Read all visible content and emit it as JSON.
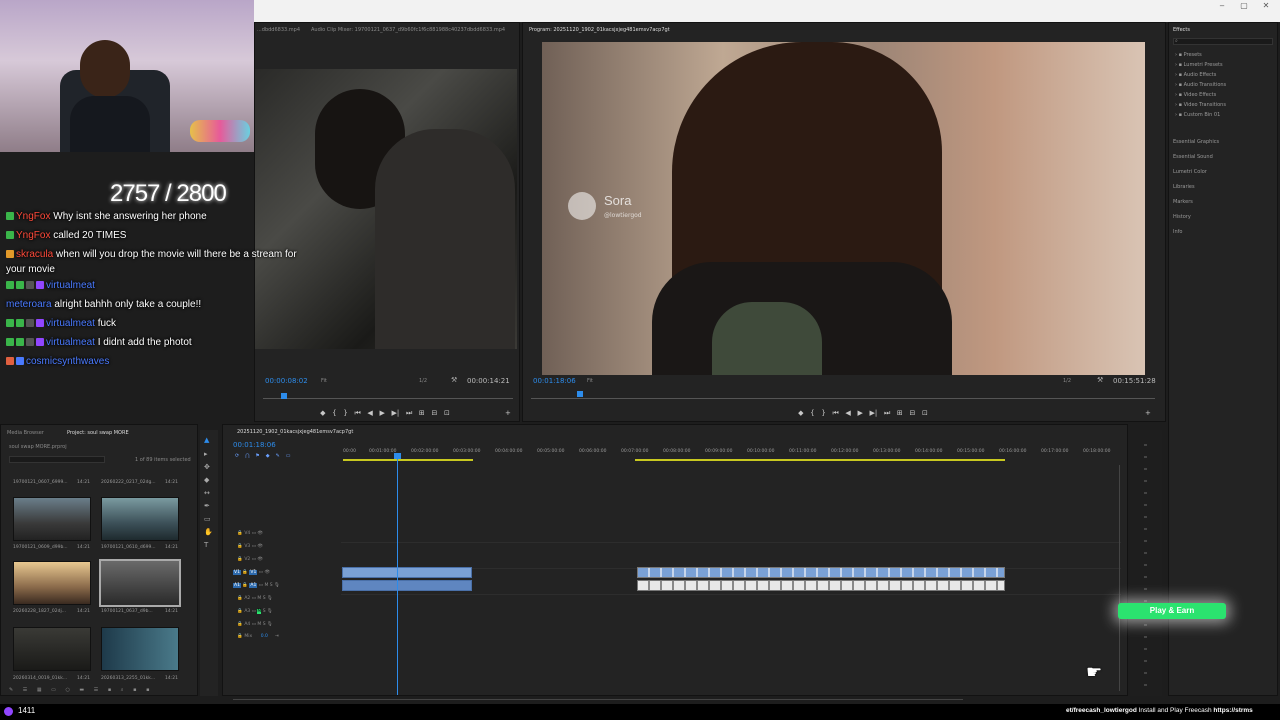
{
  "window": {
    "min": "‒",
    "max": "▢",
    "close": "✕"
  },
  "source_monitor": {
    "tabs": [
      "...dbdd6833.mp4",
      "Audio Clip Mixer: 19700121_0637_d9b60fc1f6c881988c40237dbdd6833.mp4"
    ],
    "timecode": "00:00:08:02",
    "fit": "Fit",
    "resolution": "1/2",
    "duration": "00:00:14:21"
  },
  "program_monitor": {
    "title": "Program: 20251120_1902_01kacsjxjeg481emsv7acp7gt",
    "timecode": "00:01:18:06",
    "fit": "Fit",
    "resolution": "1/2",
    "duration": "00:15:51:28",
    "watermark_title": "Sora",
    "watermark_handle": "@lowtiergod"
  },
  "effects": {
    "title": "Effects",
    "tree": [
      "Presets",
      "Lumetri Presets",
      "Audio Effects",
      "Audio Transitions",
      "Video Effects",
      "Video Transitions",
      "Custom Bin 01"
    ],
    "panels": [
      "Essential Graphics",
      "Essential Sound",
      "Lumetri Color",
      "Libraries",
      "Markers",
      "History",
      "Info"
    ]
  },
  "stream": {
    "goal": "2757 / 2800",
    "chat": [
      {
        "name": "YngFox",
        "msg": "Why isnt she answering her phone",
        "color": "red"
      },
      {
        "name": "YngFox",
        "msg": "called 20 TIMES",
        "color": "red"
      },
      {
        "name": "skracula",
        "msg": "when will you drop the movie will there be a stream for",
        "color": "red"
      },
      {
        "name": "",
        "msg": "your movie",
        "color": "red"
      },
      {
        "name": "virtualmeat",
        "msg": "",
        "color": "blue"
      },
      {
        "name": "meteroara",
        "msg": "alright bahhh only take a couple!!",
        "color": "blue"
      },
      {
        "name": "virtualmeat",
        "msg": "fuck",
        "color": "blue"
      },
      {
        "name": "virtualmeat",
        "msg": "I didnt add the photot",
        "color": "blue"
      },
      {
        "name": "cosmicsynthwaves",
        "msg": "",
        "color": "blue"
      }
    ]
  },
  "project": {
    "tabs": [
      "Media Browser",
      "Project: soul swap MORE"
    ],
    "file": "soul swap MORE.prproj",
    "selected": "1 of 89 items selected",
    "clips": [
      {
        "name": "19700121_0607_6999...",
        "dur": "14:21"
      },
      {
        "name": "20260222_0217_02dg...",
        "dur": "14:21"
      },
      {
        "name": "19700121_0609_d99b...",
        "dur": "14:21"
      },
      {
        "name": "19700121_0610_d699...",
        "dur": "14:21"
      },
      {
        "name": "20260228_1827_02dj...",
        "dur": "14:21"
      },
      {
        "name": "19700121_0637_d9b...",
        "dur": "14:21"
      },
      {
        "name": "20260314_0019_01kk...",
        "dur": "14:21"
      },
      {
        "name": "20260313_2255_01kk...",
        "dur": "14:21"
      }
    ]
  },
  "timeline": {
    "tab": "20251120_1902_01kacsjxjeg481emsv7acp7gt",
    "timecode": "00:01:18:06",
    "ruler": [
      "00:00",
      "00:01:00:00",
      "00:02:00:00",
      "00:03:00:00",
      "00:04:00:00",
      "00:05:00:00",
      "00:06:00:00",
      "00:07:00:00",
      "00:08:00:00",
      "00:09:00:00",
      "00:10:00:00",
      "00:11:00:00",
      "00:12:00:00",
      "00:13:00:00",
      "00:14:00:00",
      "00:15:00:00",
      "00:16:00:00",
      "00:17:00:00",
      "00:18:00:00"
    ],
    "tracks": [
      "V4",
      "V3",
      "V2",
      "V1",
      "A1",
      "A2",
      "A3",
      "A4",
      "Mix"
    ],
    "mix_value": "0.0"
  },
  "overlay": {
    "play_earn": "Play & Earn",
    "ticker_link": "et/freecash_lowtiergod",
    "ticker_text": " Install and Play Freecash ",
    "ticker_url": "https://strms",
    "viewer_count": "1411"
  },
  "colors": {
    "accent": "#2d8ceb",
    "earn": "#2be36f",
    "clip_video": "#7aa1d6"
  }
}
